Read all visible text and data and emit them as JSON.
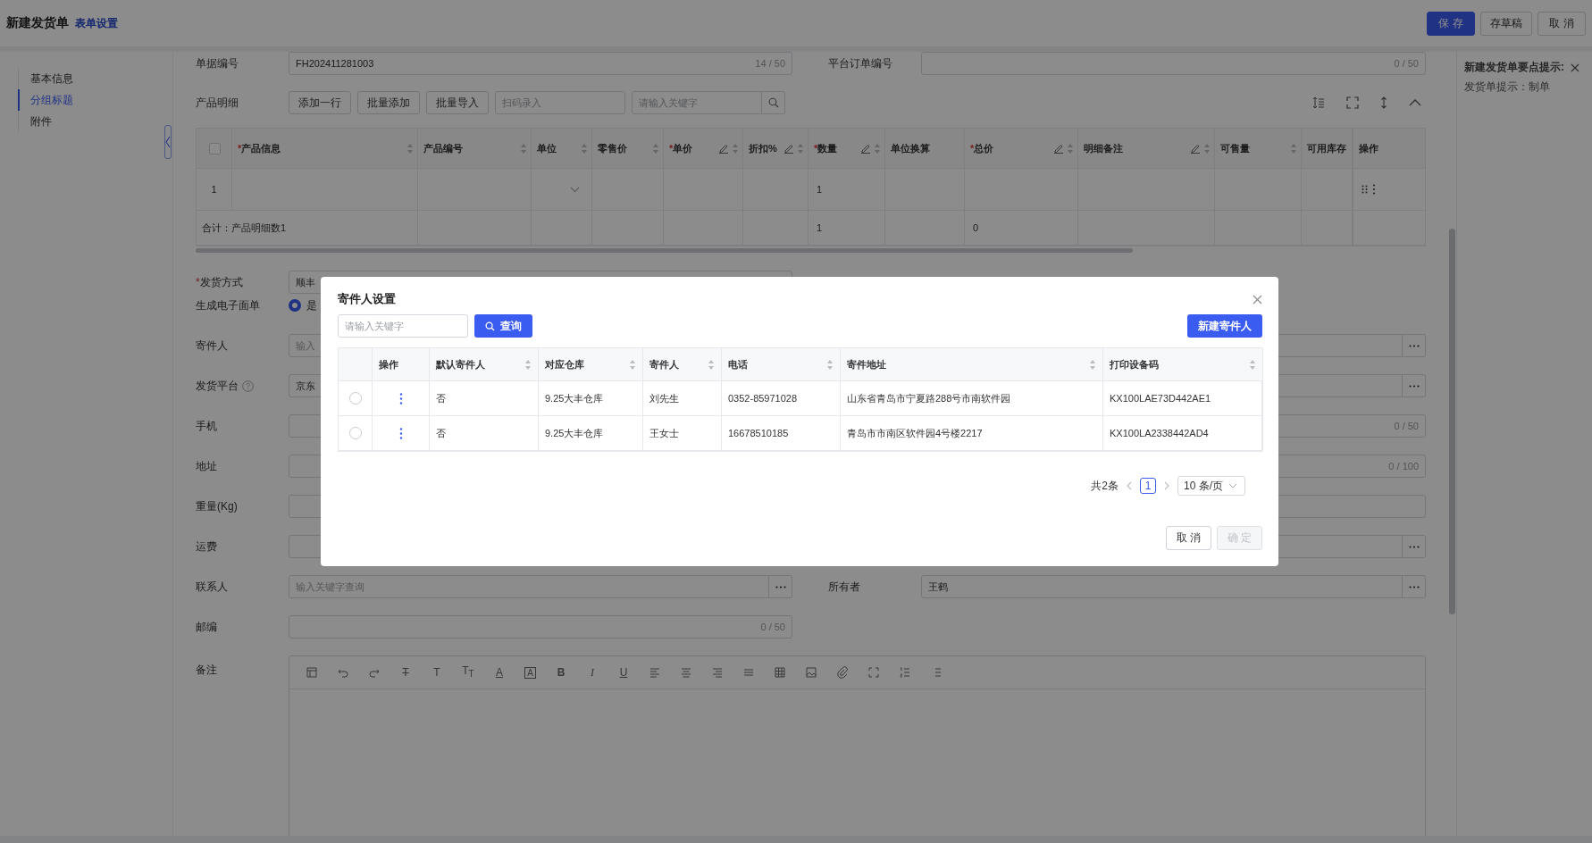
{
  "header": {
    "title": "新建发货单",
    "settings_link": "表单设置",
    "buttons": [
      {
        "label": "保存",
        "kind": "primary"
      },
      {
        "label": "存草稿",
        "kind": "default"
      },
      {
        "label": "取消",
        "kind": "default"
      }
    ]
  },
  "sidebar": {
    "items": [
      {
        "label": "基本信息",
        "selected": false
      },
      {
        "label": "分组标题",
        "selected": true
      },
      {
        "label": "附件",
        "selected": false
      }
    ]
  },
  "doc_number": {
    "label": "单据编号",
    "value": "FH202411281003",
    "counter": "14 / 50"
  },
  "platform_order": {
    "label": "平台订单编号",
    "counter": "0 / 50"
  },
  "product_detail": {
    "label": "产品明细",
    "buttons": [
      "添加一行",
      "批量添加",
      "批量导入"
    ],
    "scan_placeholder": "扫码录入",
    "search_placeholder": "请输入关键字",
    "header_checkbox": {
      "checked": false
    },
    "columns": [
      {
        "label": "产品信息",
        "mark": "*",
        "editable": false,
        "sortable": true
      },
      {
        "label": "产品编号",
        "editable": false,
        "sortable": true
      },
      {
        "label": "单位",
        "editable": false,
        "sortable": true
      },
      {
        "label": "零售价",
        "editable": false,
        "sortable": true
      },
      {
        "label": "单价",
        "mark": "*",
        "editable": true,
        "sortable": true
      },
      {
        "label": "折扣%",
        "editable": true,
        "sortable": true
      },
      {
        "label": "数量",
        "mark": "*",
        "editable": true,
        "sortable": true
      },
      {
        "label": "单位换算",
        "editable": false,
        "sortable": false
      },
      {
        "label": "总价",
        "mark": "*",
        "editable": true,
        "sortable": true
      },
      {
        "label": "明细备注",
        "editable": true,
        "sortable": true
      },
      {
        "label": "可售量",
        "editable": false,
        "sortable": true
      },
      {
        "label": "可用库存",
        "editable": false,
        "sortable": false
      },
      {
        "label": "操作",
        "editable": false,
        "sortable": false
      }
    ],
    "rows": [
      {
        "kind": "item",
        "index": "1",
        "unit_select": true,
        "quantity": "1",
        "actions": true
      },
      {
        "kind": "total",
        "label": "合计：产品明细数1",
        "quantity": "1",
        "total": "0"
      }
    ]
  },
  "form_rows": [
    {
      "left": {
        "kind": "input",
        "label": "发货方式",
        "mark": "*",
        "value": "顺丰",
        "lookup": false
      }
    },
    {
      "left": {
        "kind": "radio",
        "label": "生成电子面单",
        "options": [
          {
            "label": "是",
            "selected": true
          }
        ]
      }
    },
    {
      "left": {
        "kind": "input",
        "label": "寄件人",
        "placeholder": "输入",
        "lookup": false
      },
      "right": {
        "kind": "input",
        "lookup": true
      }
    },
    {
      "left": {
        "kind": "input",
        "label": "发货平台",
        "help": true,
        "value": "京东",
        "lookup": false
      },
      "right": {
        "kind": "input",
        "lookup": true
      }
    },
    {
      "left": {
        "kind": "input",
        "label": "手机",
        "lookup": false
      },
      "right": {
        "kind": "input",
        "counter": "0 / 50",
        "lookup": false
      }
    },
    {
      "left": {
        "kind": "input",
        "label": "地址",
        "lookup": false
      },
      "right": {
        "kind": "input",
        "counter": "0 / 100",
        "lookup": false
      }
    },
    {
      "left": {
        "kind": "input",
        "label": "重量(Kg)",
        "lookup": false
      },
      "right": {
        "kind": "input",
        "lookup": false
      }
    },
    {
      "left": {
        "kind": "input",
        "label": "运费",
        "lookup": false
      },
      "right": {
        "kind": "input",
        "lookup": true
      }
    },
    {
      "left": {
        "kind": "input",
        "label": "联系人",
        "placeholder": "输入关键字查询",
        "lookup": true
      },
      "right": {
        "kind": "input",
        "label": "所有者",
        "value": "王鹤",
        "lookup": true
      }
    },
    {
      "left": {
        "kind": "input",
        "label": "邮编",
        "counter": "0 / 50",
        "lookup": false
      }
    },
    {
      "left": {
        "kind": "editor",
        "label": "备注",
        "tools": [
          {
            "kind": "layout"
          },
          {
            "kind": "undo"
          },
          {
            "kind": "redo"
          },
          {
            "kind": "strike",
            "glyph": "T"
          },
          {
            "kind": "size",
            "glyph": "T"
          },
          {
            "kind": "clear",
            "glyph": "T$_{T}$"
          },
          {
            "kind": "color",
            "glyph": "A"
          },
          {
            "kind": "highlight",
            "glyph": "A"
          },
          {
            "kind": "bold",
            "glyph": "B"
          },
          {
            "kind": "italic",
            "glyph": "I"
          },
          {
            "kind": "underline",
            "glyph": "U"
          },
          {
            "kind": "align-left"
          },
          {
            "kind": "align-center"
          },
          {
            "kind": "align-right"
          },
          {
            "kind": "justify"
          },
          {
            "kind": "table"
          },
          {
            "kind": "image"
          },
          {
            "kind": "attach"
          },
          {
            "kind": "fullscreen"
          },
          {
            "kind": "ordered-list"
          },
          {
            "kind": "bullet-list"
          }
        ]
      }
    }
  ],
  "tips": {
    "title": "新建发货单要点提示:",
    "text": "发货单提示：制单"
  },
  "dialog": {
    "title": "寄件人设置",
    "search_placeholder": "请输入关键字",
    "search_button": "查询",
    "new_button": "新建寄件人",
    "action_column": {
      "label": "操作"
    },
    "columns": [
      {
        "label": "默认寄件人",
        "sortable": true
      },
      {
        "label": "对应仓库",
        "sortable": true
      },
      {
        "label": "寄件人",
        "sortable": true
      },
      {
        "label": "电话",
        "sortable": true
      },
      {
        "label": "寄件地址",
        "sortable": true
      },
      {
        "label": "打印设备码",
        "sortable": true
      }
    ],
    "rows": [
      {
        "selected": false,
        "cells": [
          "否",
          "9.25大丰仓库",
          "刘先生",
          "0352-85971028",
          "山东省青岛市宁夏路288号市南软件园",
          "KX100LAE73D442AE1"
        ]
      },
      {
        "selected": false,
        "cells": [
          "否",
          "9.25大丰仓库",
          "王女士",
          "16678510185",
          "青岛市市南区软件园4号楼2217",
          "KX100LA2338442AD4"
        ]
      }
    ],
    "pagination": {
      "total": "共2条",
      "pages": [
        {
          "label": "1",
          "selected": true
        }
      ],
      "page_size": "10 条/页"
    },
    "buttons": [
      {
        "label": "取消",
        "disabled": false
      },
      {
        "label": "确定",
        "disabled": true
      }
    ]
  }
}
